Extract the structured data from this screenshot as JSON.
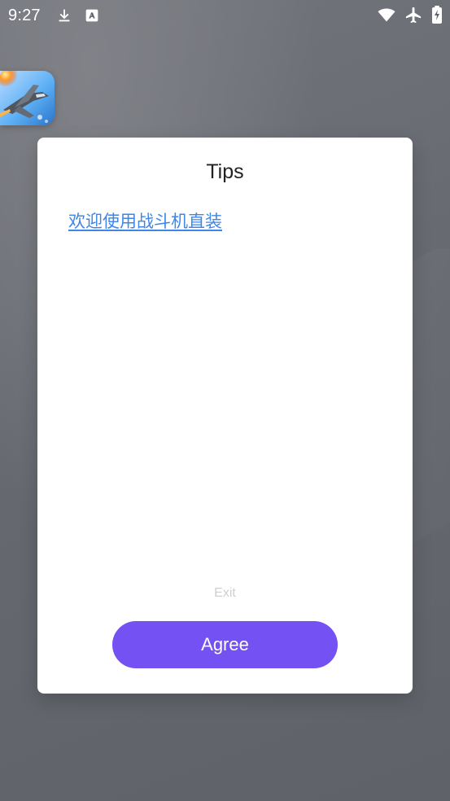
{
  "status_bar": {
    "time": "9:27",
    "icons": [
      "download-icon",
      "font-icon",
      "wifi-icon",
      "airplane-mode-icon",
      "battery-icon"
    ]
  },
  "app": {
    "icon": "fighter-jet-game-icon"
  },
  "dialog": {
    "title": "Tips",
    "link_text": "欢迎使用战斗机直装",
    "exit_label": "Exit",
    "agree_label": "Agree"
  },
  "colors": {
    "background": "#686b72",
    "dialog": "#ffffff",
    "link": "#3f86e8",
    "exit_text": "#cfcfcf",
    "primary_button": "#7451f2"
  }
}
